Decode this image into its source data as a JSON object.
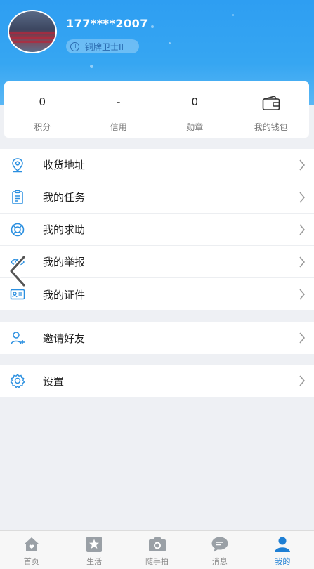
{
  "profile": {
    "phone": "177****2007",
    "badge_icon": "II",
    "badge": "铜牌卫士II"
  },
  "stats": [
    {
      "value": "0",
      "label": "积分"
    },
    {
      "value": "-",
      "label": "信用"
    },
    {
      "value": "0",
      "label": "勋章"
    },
    {
      "icon": "wallet-icon",
      "label": "我的钱包"
    }
  ],
  "menu_group1": [
    {
      "icon": "location-pin-icon",
      "label": "收货地址"
    },
    {
      "icon": "task-list-icon",
      "label": "我的任务"
    },
    {
      "icon": "lifebuoy-icon",
      "label": "我的求助"
    },
    {
      "icon": "eye-icon",
      "label": "我的举报"
    },
    {
      "icon": "id-card-icon",
      "label": "我的证件"
    }
  ],
  "menu_group2": [
    {
      "icon": "add-user-icon",
      "label": "邀请好友"
    }
  ],
  "menu_group3": [
    {
      "icon": "gear-icon",
      "label": "设置"
    }
  ],
  "tabbar": [
    {
      "icon": "home-icon",
      "label": "首页"
    },
    {
      "icon": "star-icon",
      "label": "生活"
    },
    {
      "icon": "camera-icon",
      "label": "随手拍"
    },
    {
      "icon": "chat-icon",
      "label": "消息"
    },
    {
      "icon": "user-icon",
      "label": "我的",
      "active": true
    }
  ],
  "colors": {
    "header_blue": "#2e9ef2",
    "icon_blue": "#2a8fe0",
    "active_tab": "#1e7fd4"
  }
}
